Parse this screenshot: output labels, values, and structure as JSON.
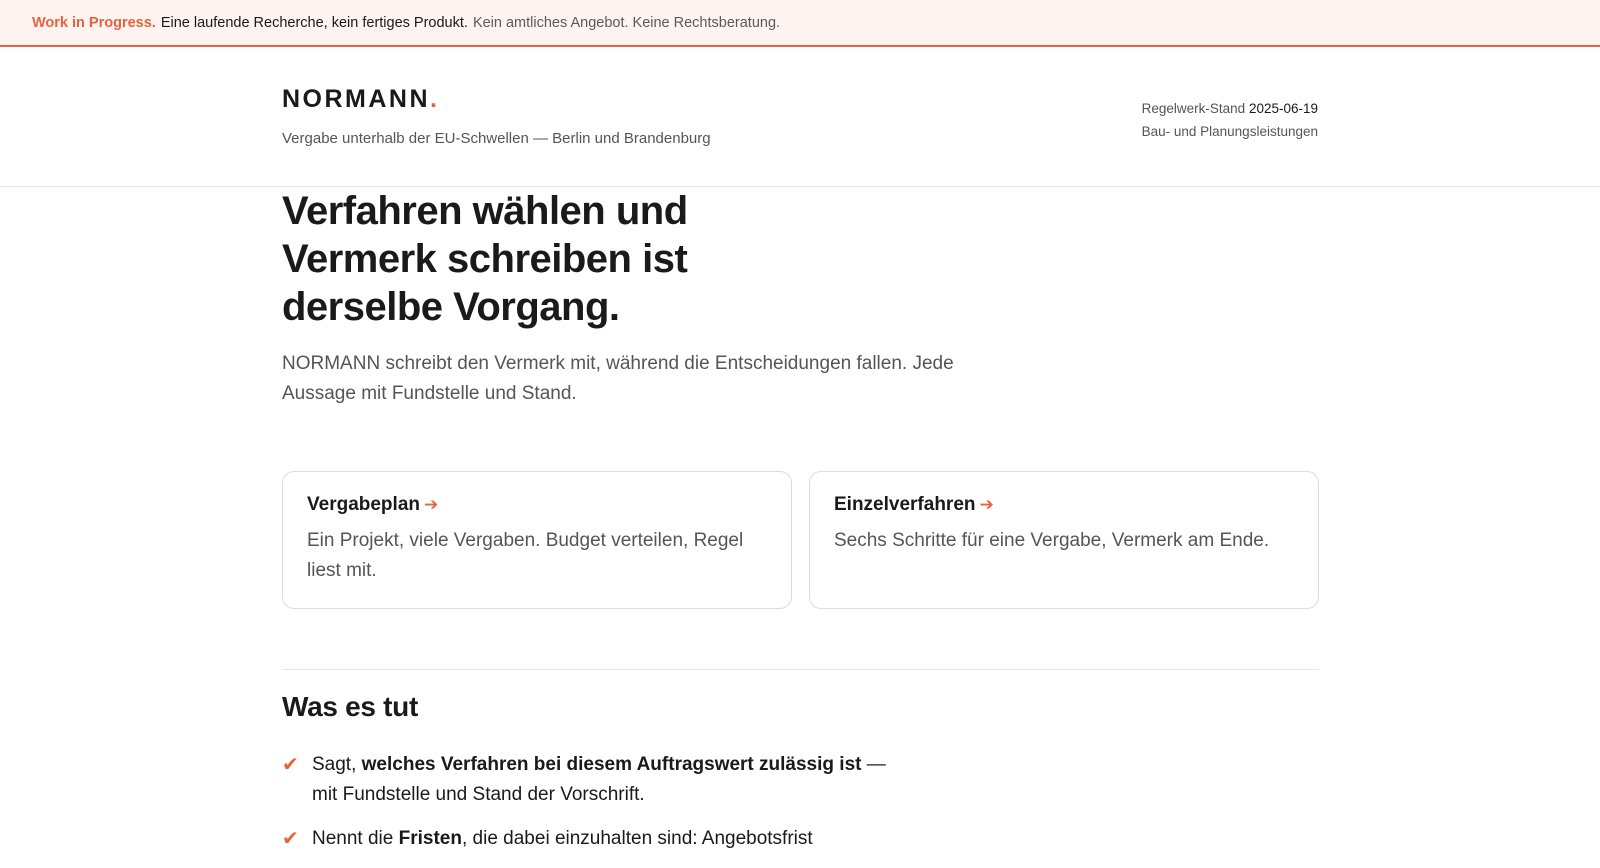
{
  "banner": {
    "tag": "Work in Progress.",
    "main": "Eine laufende Recherche, kein fertiges Produkt.",
    "note": "Kein amtliches Angebot. Keine Rechtsberatung."
  },
  "header": {
    "logo": "NORMANN",
    "logo_dot": ".",
    "tagline": "Vergabe unterhalb der EU-Schwellen — Berlin und Brandenburg",
    "meta_label": "Regelwerk-Stand",
    "meta_date": "2025-06-19",
    "meta_scope": "Bau- und Planungsleistungen"
  },
  "hero": {
    "title": "Verfahren wählen und Vermerk schreiben ist derselbe Vorgang.",
    "lead": "NORMANN schreibt den Vermerk mit, während die Entscheidungen fallen. Jede Aussage mit Fundstelle und Stand."
  },
  "cards": [
    {
      "title": "Vergabeplan",
      "arrow": "➔",
      "desc": "Ein Projekt, viele Vergaben. Budget verteilen, Regel liest mit."
    },
    {
      "title": "Einzelverfahren",
      "arrow": "➔",
      "desc": "Sechs Schritte für eine Vergabe, Vermerk am Ende."
    }
  ],
  "section": {
    "title": "Was es tut",
    "check": "✔",
    "items": [
      {
        "pre": "Sagt, ",
        "bold": "welches Verfahren bei diesem Auftragswert zulässig ist",
        "post": " — mit Fundstelle und Stand der Vorschrift."
      },
      {
        "pre": "Nennt die ",
        "bold": "Fristen",
        "post": ", die dabei einzuhalten sind: Angebotsfrist"
      }
    ]
  }
}
